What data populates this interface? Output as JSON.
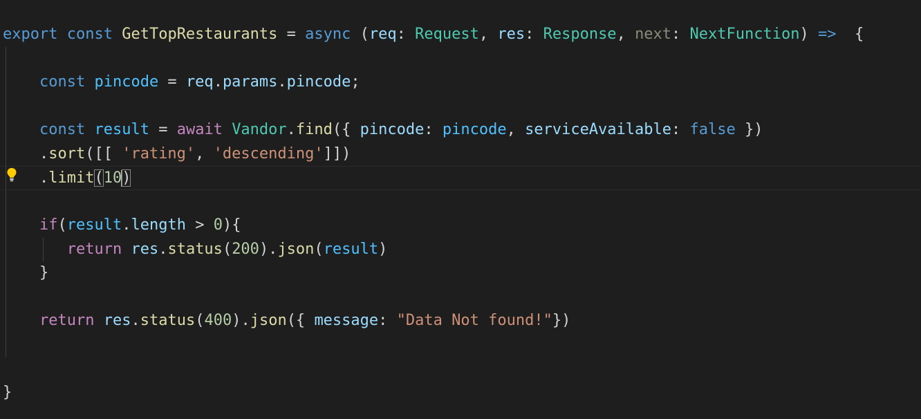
{
  "editor": {
    "colors": {
      "background": "#1e1e1e",
      "keyword": "#569cd6",
      "control": "#c586c0",
      "function": "#dcdcaa",
      "variable": "#9cdcfe",
      "type": "#4ec9b0",
      "string": "#ce9178",
      "number": "#b5cea8"
    },
    "lightbulb_icon": "lightbulb-icon",
    "lines": [
      {
        "indent": "",
        "tokens": [
          {
            "t": "export",
            "c": "kw"
          },
          {
            "t": " ",
            "c": "punc"
          },
          {
            "t": "const",
            "c": "kw"
          },
          {
            "t": " ",
            "c": "punc"
          },
          {
            "t": "GetTopRestaurants",
            "c": "fn"
          },
          {
            "t": " = ",
            "c": "punc"
          },
          {
            "t": "async",
            "c": "kw"
          },
          {
            "t": " (",
            "c": "punc"
          },
          {
            "t": "req",
            "c": "var"
          },
          {
            "t": ": ",
            "c": "punc"
          },
          {
            "t": "Request",
            "c": "type"
          },
          {
            "t": ", ",
            "c": "punc"
          },
          {
            "t": "res",
            "c": "var"
          },
          {
            "t": ": ",
            "c": "punc"
          },
          {
            "t": "Response",
            "c": "type"
          },
          {
            "t": ", ",
            "c": "punc"
          },
          {
            "t": "next",
            "c": "dim"
          },
          {
            "t": ": ",
            "c": "punc"
          },
          {
            "t": "NextFunction",
            "c": "type"
          },
          {
            "t": ") ",
            "c": "punc"
          },
          {
            "t": "=>",
            "c": "kw"
          },
          {
            "t": "  {",
            "c": "punc"
          }
        ]
      },
      {
        "indent": "",
        "tokens": []
      },
      {
        "indent": "    ",
        "tokens": [
          {
            "t": "const",
            "c": "kw"
          },
          {
            "t": " ",
            "c": "punc"
          },
          {
            "t": "pincode",
            "c": "cnst"
          },
          {
            "t": " = ",
            "c": "punc"
          },
          {
            "t": "req",
            "c": "var"
          },
          {
            "t": ".",
            "c": "punc"
          },
          {
            "t": "params",
            "c": "var"
          },
          {
            "t": ".",
            "c": "punc"
          },
          {
            "t": "pincode",
            "c": "var"
          },
          {
            "t": ";",
            "c": "punc"
          }
        ]
      },
      {
        "indent": "",
        "tokens": []
      },
      {
        "indent": "    ",
        "tokens": [
          {
            "t": "const",
            "c": "kw"
          },
          {
            "t": " ",
            "c": "punc"
          },
          {
            "t": "result",
            "c": "cnst"
          },
          {
            "t": " = ",
            "c": "punc"
          },
          {
            "t": "await",
            "c": "ctl"
          },
          {
            "t": " ",
            "c": "punc"
          },
          {
            "t": "Vandor",
            "c": "type"
          },
          {
            "t": ".",
            "c": "punc"
          },
          {
            "t": "find",
            "c": "fn"
          },
          {
            "t": "({ ",
            "c": "punc"
          },
          {
            "t": "pincode",
            "c": "var"
          },
          {
            "t": ": ",
            "c": "punc"
          },
          {
            "t": "pincode",
            "c": "cnst"
          },
          {
            "t": ", ",
            "c": "punc"
          },
          {
            "t": "serviceAvailable",
            "c": "var"
          },
          {
            "t": ": ",
            "c": "punc"
          },
          {
            "t": "false",
            "c": "bool"
          },
          {
            "t": " })",
            "c": "punc"
          }
        ]
      },
      {
        "indent": "    ",
        "tokens": [
          {
            "t": ".",
            "c": "punc"
          },
          {
            "t": "sort",
            "c": "fn"
          },
          {
            "t": "([[ ",
            "c": "punc"
          },
          {
            "t": "'rating'",
            "c": "str"
          },
          {
            "t": ", ",
            "c": "punc"
          },
          {
            "t": "'descending'",
            "c": "str"
          },
          {
            "t": "]])",
            "c": "punc"
          }
        ]
      },
      {
        "indent": "    ",
        "cursor": true,
        "tokens": [
          {
            "t": ".",
            "c": "punc"
          },
          {
            "t": "limit",
            "c": "fn"
          },
          {
            "t": "(",
            "c": "punc",
            "match": true
          },
          {
            "t": "10",
            "c": "num"
          },
          {
            "t": "CARET",
            "c": "caret"
          },
          {
            "t": ")",
            "c": "punc",
            "match": true
          }
        ]
      },
      {
        "indent": "",
        "tokens": []
      },
      {
        "indent": "    ",
        "tokens": [
          {
            "t": "if",
            "c": "ctl"
          },
          {
            "t": "(",
            "c": "punc"
          },
          {
            "t": "result",
            "c": "cnst"
          },
          {
            "t": ".",
            "c": "punc"
          },
          {
            "t": "length",
            "c": "var"
          },
          {
            "t": " > ",
            "c": "punc"
          },
          {
            "t": "0",
            "c": "num"
          },
          {
            "t": "){",
            "c": "punc"
          }
        ]
      },
      {
        "indent": "       ",
        "tokens": [
          {
            "t": "return",
            "c": "ctl"
          },
          {
            "t": " ",
            "c": "punc"
          },
          {
            "t": "res",
            "c": "var"
          },
          {
            "t": ".",
            "c": "punc"
          },
          {
            "t": "status",
            "c": "fn"
          },
          {
            "t": "(",
            "c": "punc"
          },
          {
            "t": "200",
            "c": "num"
          },
          {
            "t": ").",
            "c": "punc"
          },
          {
            "t": "json",
            "c": "fn"
          },
          {
            "t": "(",
            "c": "punc"
          },
          {
            "t": "result",
            "c": "cnst"
          },
          {
            "t": ")",
            "c": "punc"
          }
        ]
      },
      {
        "indent": "    ",
        "tokens": [
          {
            "t": "}",
            "c": "punc"
          }
        ]
      },
      {
        "indent": "",
        "tokens": []
      },
      {
        "indent": "    ",
        "tokens": [
          {
            "t": "return",
            "c": "ctl"
          },
          {
            "t": " ",
            "c": "punc"
          },
          {
            "t": "res",
            "c": "var"
          },
          {
            "t": ".",
            "c": "punc"
          },
          {
            "t": "status",
            "c": "fn"
          },
          {
            "t": "(",
            "c": "punc"
          },
          {
            "t": "400",
            "c": "num"
          },
          {
            "t": ").",
            "c": "punc"
          },
          {
            "t": "json",
            "c": "fn"
          },
          {
            "t": "({ ",
            "c": "punc"
          },
          {
            "t": "message",
            "c": "var"
          },
          {
            "t": ": ",
            "c": "punc"
          },
          {
            "t": "\"Data Not found!\"",
            "c": "str"
          },
          {
            "t": "})",
            "c": "punc"
          }
        ]
      },
      {
        "indent": "",
        "tokens": []
      },
      {
        "indent": "",
        "tokens": []
      },
      {
        "indent": "",
        "tokens": [
          {
            "t": "}",
            "c": "punc"
          }
        ]
      }
    ]
  }
}
